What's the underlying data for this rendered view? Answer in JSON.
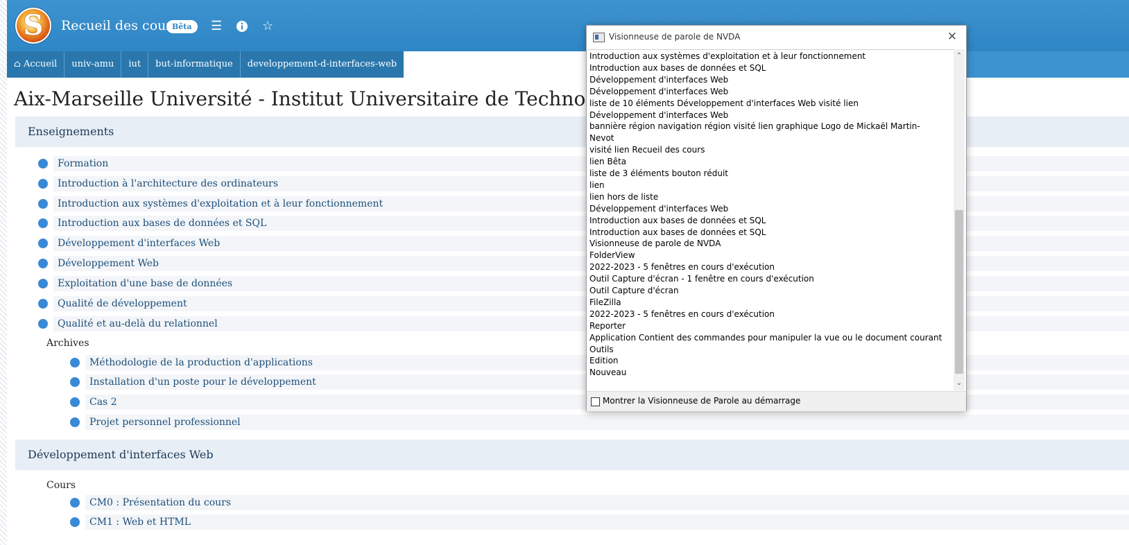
{
  "header": {
    "site_title": "Recueil des cours",
    "beta_badge": "Bêta",
    "menu_icon": "bars-icon",
    "info_icon": "info-circle-icon",
    "favorite_icon": "star-outline-icon"
  },
  "breadcrumb": [
    {
      "label": "Accueil",
      "icon": "home-icon"
    },
    {
      "label": "univ-amu"
    },
    {
      "label": "iut"
    },
    {
      "label": "but-informatique"
    },
    {
      "label": "developpement-d-interfaces-web"
    }
  ],
  "page_title": "Aix-Marseille Université - Institut Universitaire de Technologie d'",
  "sections": [
    {
      "title": "Enseignements",
      "items": [
        "Formation",
        "Introduction à l'architecture des ordinateurs",
        "Introduction aux systèmes d'exploitation et à leur fonctionnement",
        "Introduction aux bases de données et SQL",
        "Développement d'interfaces Web",
        "Développement Web",
        "Exploitation d'une base de données",
        "Qualité de développement",
        "Qualité et au-delà du relationnel"
      ],
      "sub_label": "Archives",
      "sub_items": [
        "Méthodologie de la production d'applications",
        "Installation d'un poste pour le développement",
        "Cas 2",
        "Projet personnel professionnel"
      ]
    },
    {
      "title": "Développement d'interfaces Web",
      "sub_label": "Cours",
      "sub_items": [
        "CM0 : Présentation du cours",
        "CM1 : Web et HTML"
      ]
    }
  ],
  "nvda": {
    "title": "Visionneuse de parole de NVDA",
    "lines": [
      "Introduction aux systèmes d'exploitation et à leur fonctionnement",
      "Introduction aux bases de données et SQL",
      "Développement d'interfaces Web",
      "Développement d'interfaces Web",
      "liste  de 10 éléments  Développement d'interfaces Web  visité  lien",
      "Développement d'interfaces Web",
      "bannière région    navigation région    visité  lien    graphique    Logo de Mickaël Martin-",
      "Nevot",
      "visité  lien    Recueil des cours",
      "lien    Bêta",
      "liste  de 3 éléments  bouton  réduit",
      "lien",
      "lien    hors de liste",
      "Développement d'interfaces Web",
      "Introduction aux bases de données et SQL",
      "Introduction aux bases de données et SQL",
      "Visionneuse de parole de NVDA",
      "FolderView",
      "2022-2023 - 5 fenêtres en cours d'exécution",
      "Outil Capture d'écran - 1 fenêtre en cours d'exécution",
      "Outil Capture d'écran",
      "FileZilla",
      "2022-2023 - 5 fenêtres en cours d'exécution",
      "Reporter",
      "Application Contient des commandes pour manipuler la vue ou le document courant",
      "Outils",
      "Edition",
      "Nouveau"
    ],
    "checkbox_label": "Montrer la Visionneuse de Parole au démarrage",
    "checkbox_checked": false
  }
}
